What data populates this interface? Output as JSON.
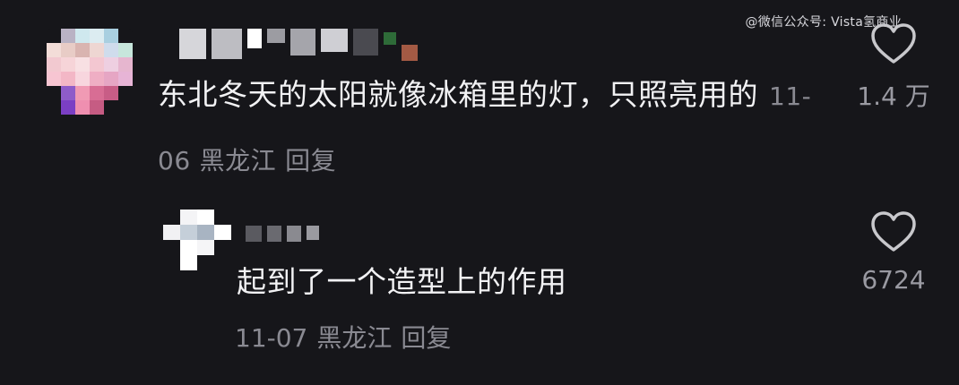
{
  "watermark": "@微信公众号: Vista氢商业",
  "colors": {
    "background": "#16161a",
    "text": "#f2f2f4",
    "meta": "#8a8a92",
    "icon": "#c8c8cc"
  },
  "comment": {
    "text": "东北冬天的太阳就像冰箱里的灯，只照亮用的",
    "date": "11-06",
    "location": "黑龙江",
    "reply_label": "回复",
    "likes": "1.4 万",
    "like_icon": "heart-outline-icon"
  },
  "reply": {
    "text": "起到了一个造型上的作用",
    "date": "11-07",
    "location": "黑龙江",
    "reply_label": "回复",
    "likes": "6724",
    "like_icon": "heart-outline-icon"
  }
}
